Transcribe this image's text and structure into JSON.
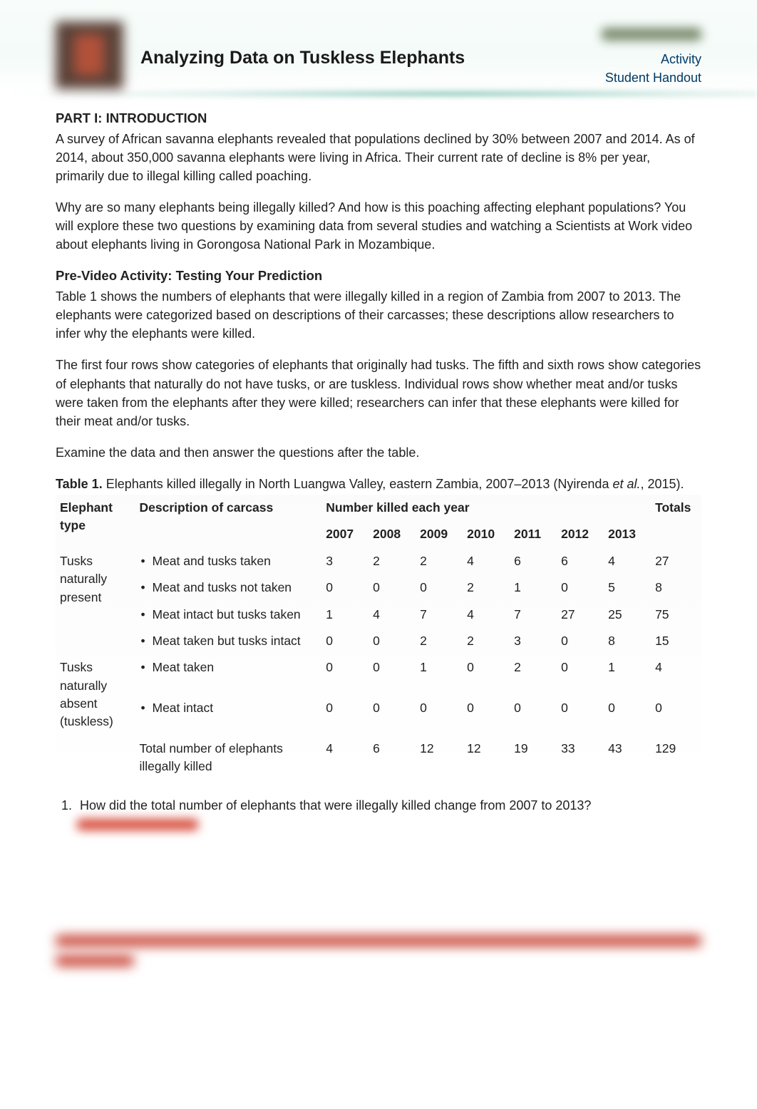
{
  "header": {
    "title": "Analyzing Data on Tuskless Elephants",
    "activity_label": "Activity",
    "handout_label": "Student Handout"
  },
  "part1": {
    "heading": "PART I: INTRODUCTION",
    "p1": "A survey of African savanna elephants revealed that populations declined by 30% between 2007 and 2014. As of 2014, about 350,000 savanna elephants were living in Africa. Their current rate of decline is 8% per year, primarily due to illegal killing called poaching.",
    "p2": "Why are so many elephants being illegally killed? And how is this poaching affecting elephant populations? You will explore these two questions by examining data from several studies and watching a Scientists at Work video about elephants living in Gorongosa National Park in Mozambique.",
    "subhead": "Pre-Video Activity: Testing Your Prediction",
    "p3": "Table 1 shows the numbers of elephants that were illegally killed in a region of Zambia from 2007 to 2013. The elephants were categorized based on descriptions of their carcasses; these descriptions allow researchers to infer why the elephants were killed.",
    "p4": "The first four rows show categories of elephants that originally had tusks. The fifth and sixth rows show categories of elephants that naturally do not have tusks, or are tuskless. Individual rows show whether meat and/or tusks were taken from the elephants after they were killed; researchers can infer that these elephants were killed for their meat and/or tusks.",
    "p5": "Examine the data and then answer the questions after the table."
  },
  "table": {
    "caption_label": "Table 1.",
    "caption_text": " Elephants killed illegally in North Luangwa Valley, eastern Zambia, 2007–2013 (Nyirenda ",
    "caption_italic": "et al.",
    "caption_tail": ", 2015).",
    "col_etype": "Elephant type",
    "col_desc": "Description of carcass",
    "col_span": "Number killed each year",
    "col_totals": "Totals",
    "years": [
      "2007",
      "2008",
      "2009",
      "2010",
      "2011",
      "2012",
      "2013"
    ],
    "group1_label": "Tusks naturally present",
    "group2_label": "Tusks naturally absent (tuskless)",
    "rows": [
      {
        "desc": "Meat and tusks taken",
        "vals": [
          "3",
          "2",
          "2",
          "4",
          "6",
          "6",
          "4"
        ],
        "total": "27"
      },
      {
        "desc": "Meat and tusks not taken",
        "vals": [
          "0",
          "0",
          "0",
          "2",
          "1",
          "0",
          "5"
        ],
        "total": "8"
      },
      {
        "desc": "Meat intact but tusks taken",
        "vals": [
          "1",
          "4",
          "7",
          "4",
          "7",
          "27",
          "25"
        ],
        "total": "75"
      },
      {
        "desc": "Meat taken but tusks intact",
        "vals": [
          "0",
          "0",
          "2",
          "2",
          "3",
          "0",
          "8"
        ],
        "total": "15"
      },
      {
        "desc": "Meat taken",
        "vals": [
          "0",
          "0",
          "1",
          "0",
          "2",
          "0",
          "1"
        ],
        "total": "4"
      },
      {
        "desc": "Meat intact",
        "vals": [
          "0",
          "0",
          "0",
          "0",
          "0",
          "0",
          "0"
        ],
        "total": "0"
      }
    ],
    "total_label": "Total number of elephants illegally killed",
    "total_vals": [
      "4",
      "6",
      "12",
      "12",
      "19",
      "33",
      "43"
    ],
    "grand_total": "129"
  },
  "questions": {
    "q1": "How did the total number of elephants that were illegally killed change from 2007 to 2013?"
  }
}
